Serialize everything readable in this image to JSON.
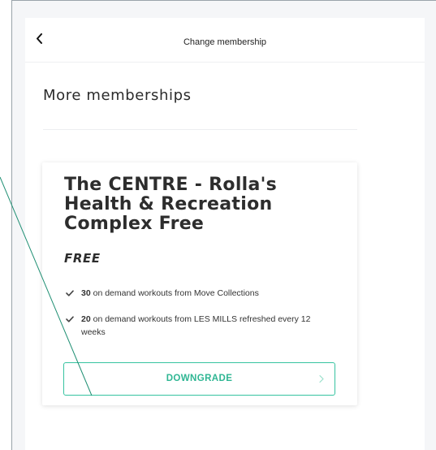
{
  "header": {
    "title": "Change membership",
    "back_icon": "chevron-left-icon"
  },
  "main": {
    "section_title": "More memberships",
    "membership": {
      "title": "The CENTRE - Rolla's Health & Recreation Complex Free",
      "price": "FREE",
      "features": [
        {
          "count": "30",
          "text": " on demand workouts from Move Collections"
        },
        {
          "count": "20",
          "text": " on demand workouts from LES MILLS refreshed every 12 weeks"
        }
      ],
      "action_label": "DOWNGRADE"
    }
  },
  "colors": {
    "accent": "#36c3a0",
    "accent_text": "#2fb693",
    "annotation_line": "#1f8f73",
    "background": "#f5f6f8"
  }
}
